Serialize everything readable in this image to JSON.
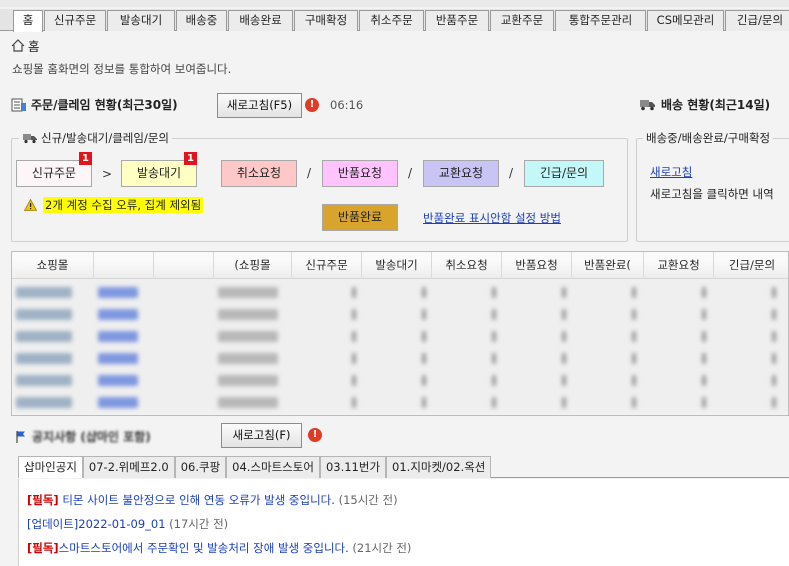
{
  "tabs": [
    {
      "label": "홈",
      "active": true
    },
    {
      "label": "신규주문"
    },
    {
      "label": "발송대기"
    },
    {
      "label": "배송중"
    },
    {
      "label": "배송완료"
    },
    {
      "label": "구매확정"
    },
    {
      "label": "취소주문"
    },
    {
      "label": "반품주문"
    },
    {
      "label": "교환주문"
    },
    {
      "label": "통합주문관리"
    },
    {
      "label": "CS메모관리"
    },
    {
      "label": "긴급/문의"
    }
  ],
  "page": {
    "title": "홈",
    "subtitle": "쇼핑몰 홈화면의 정보를 통합하여 보여줍니다."
  },
  "order_section": {
    "title": "주문/클레임 현황(최근30일)",
    "refresh_label": "새로고침(F5)",
    "time": "06:16",
    "group_label": "신규/발송대기/클레임/문의",
    "stats": [
      {
        "label": "신규주문",
        "badge": "1",
        "color": "#fdf6f8"
      },
      {
        "label": "발송대기",
        "badge": "1",
        "color": "#ffffc4"
      },
      {
        "label": "취소요청",
        "color": "#ffc8c8"
      },
      {
        "label": "반품요청",
        "color": "#ffc4ff"
      },
      {
        "label": "교환요청",
        "color": "#c8c4f4"
      },
      {
        "label": "긴급/문의",
        "color": "#c4f8f8"
      },
      {
        "label": "반품완료",
        "color": "#d8a42c"
      }
    ],
    "arrow": ">",
    "slash": "/",
    "warning": "2개 계정 수집 오류, 집계 제외됨",
    "hide_link": "반품완료 표시안함 설정 방법"
  },
  "shipping_section": {
    "title": "배송 현황(최근14일)",
    "group_label": "배송중/배송완료/구매확정",
    "refresh_link": "새로고침",
    "hint": "새로고침을 클릭하면 내역"
  },
  "grid": {
    "columns": [
      "쇼핑몰",
      "",
      "",
      "(쇼핑몰",
      "신규주문",
      "발송대기",
      "취소요청",
      "반품요청",
      "반품완료(",
      "교환요청",
      "긴급/문의"
    ]
  },
  "notice_section": {
    "title": "공지사항 (샵마인 포함)",
    "refresh_label": "새로고침(F)",
    "tabs": [
      "샵마인공지",
      "07-2.위메프2.0",
      "06.쿠팡",
      "04.스마트스토어",
      "03.11번가",
      "01.지마켓/02.옥션"
    ],
    "items": [
      {
        "category": "[필독]",
        "text": "티몬 사이트 불안정으로 인해 연동 오류가 발생 중입니다.",
        "ago": "(15시간 전)"
      },
      {
        "category": "[업데이트]",
        "text": "2022-01-09_01",
        "ago": "(17시간 전)"
      },
      {
        "category": "[필독]",
        "text": "스마트스토어에서 주문확인 및 발송처리 장애 발생 중입니다.",
        "ago": "(21시간 전)"
      }
    ]
  }
}
